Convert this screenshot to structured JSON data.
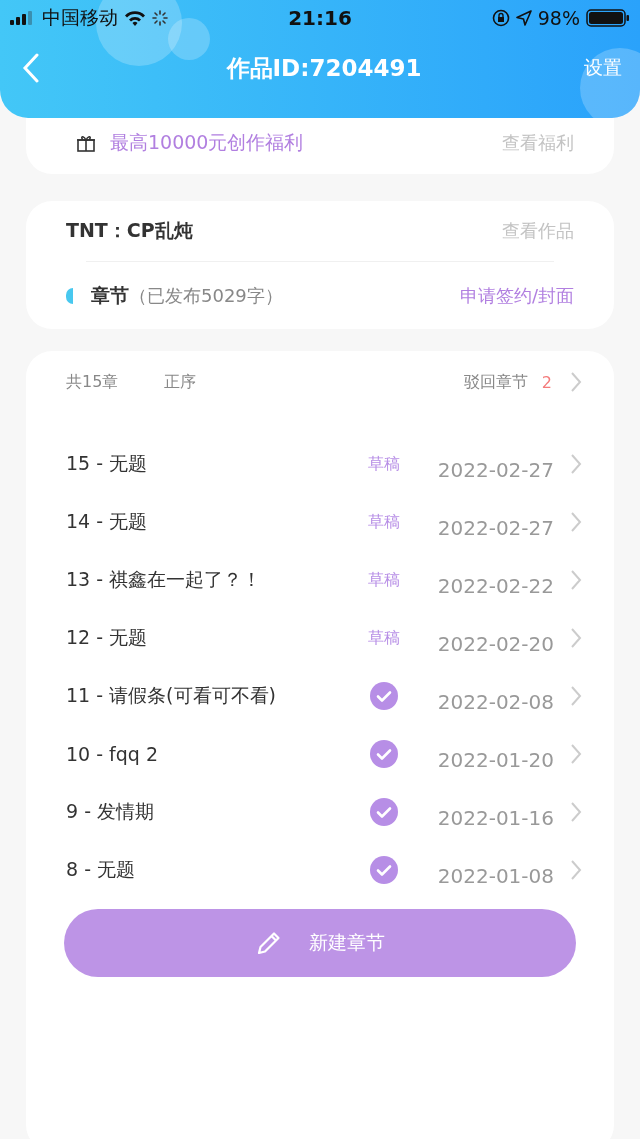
{
  "status_bar": {
    "carrier": "中国移动",
    "time": "21:16",
    "battery": "98%"
  },
  "nav": {
    "title": "作品ID:7204491",
    "action": "设置"
  },
  "benefit": {
    "text": "最高10000元创作福利",
    "link": "查看福利"
  },
  "work": {
    "title": "TNT：CP乱炖",
    "link": "查看作品",
    "section": "章节",
    "section_note": "（已发布5029字）",
    "sign_link": "申请签约/封面"
  },
  "chapters_header": {
    "total": "共15章",
    "order": "正序",
    "rejected": "驳回章节",
    "rejected_count": "2"
  },
  "chapters": [
    {
      "title": "15 - 无题",
      "status": {
        "kind": "draft",
        "label": "草稿"
      },
      "date": "2022-02-27"
    },
    {
      "title": "14 - 无题",
      "status": {
        "kind": "draft",
        "label": "草稿"
      },
      "date": "2022-02-27"
    },
    {
      "title": "13 - 祺鑫在一起了？！",
      "status": {
        "kind": "draft",
        "label": "草稿"
      },
      "date": "2022-02-22"
    },
    {
      "title": "12 - 无题",
      "status": {
        "kind": "draft",
        "label": "草稿"
      },
      "date": "2022-02-20"
    },
    {
      "title": "11 - 请假条(可看可不看)",
      "status": {
        "kind": "published"
      },
      "date": "2022-02-08"
    },
    {
      "title": "10 - fqq 2",
      "status": {
        "kind": "published"
      },
      "date": "2022-01-20"
    },
    {
      "title": "9 - 发情期",
      "status": {
        "kind": "published"
      },
      "date": "2022-01-16"
    },
    {
      "title": "8 - 无题",
      "status": {
        "kind": "published"
      },
      "date": "2022-01-08"
    }
  ],
  "new_chapter_button": "新建章节"
}
